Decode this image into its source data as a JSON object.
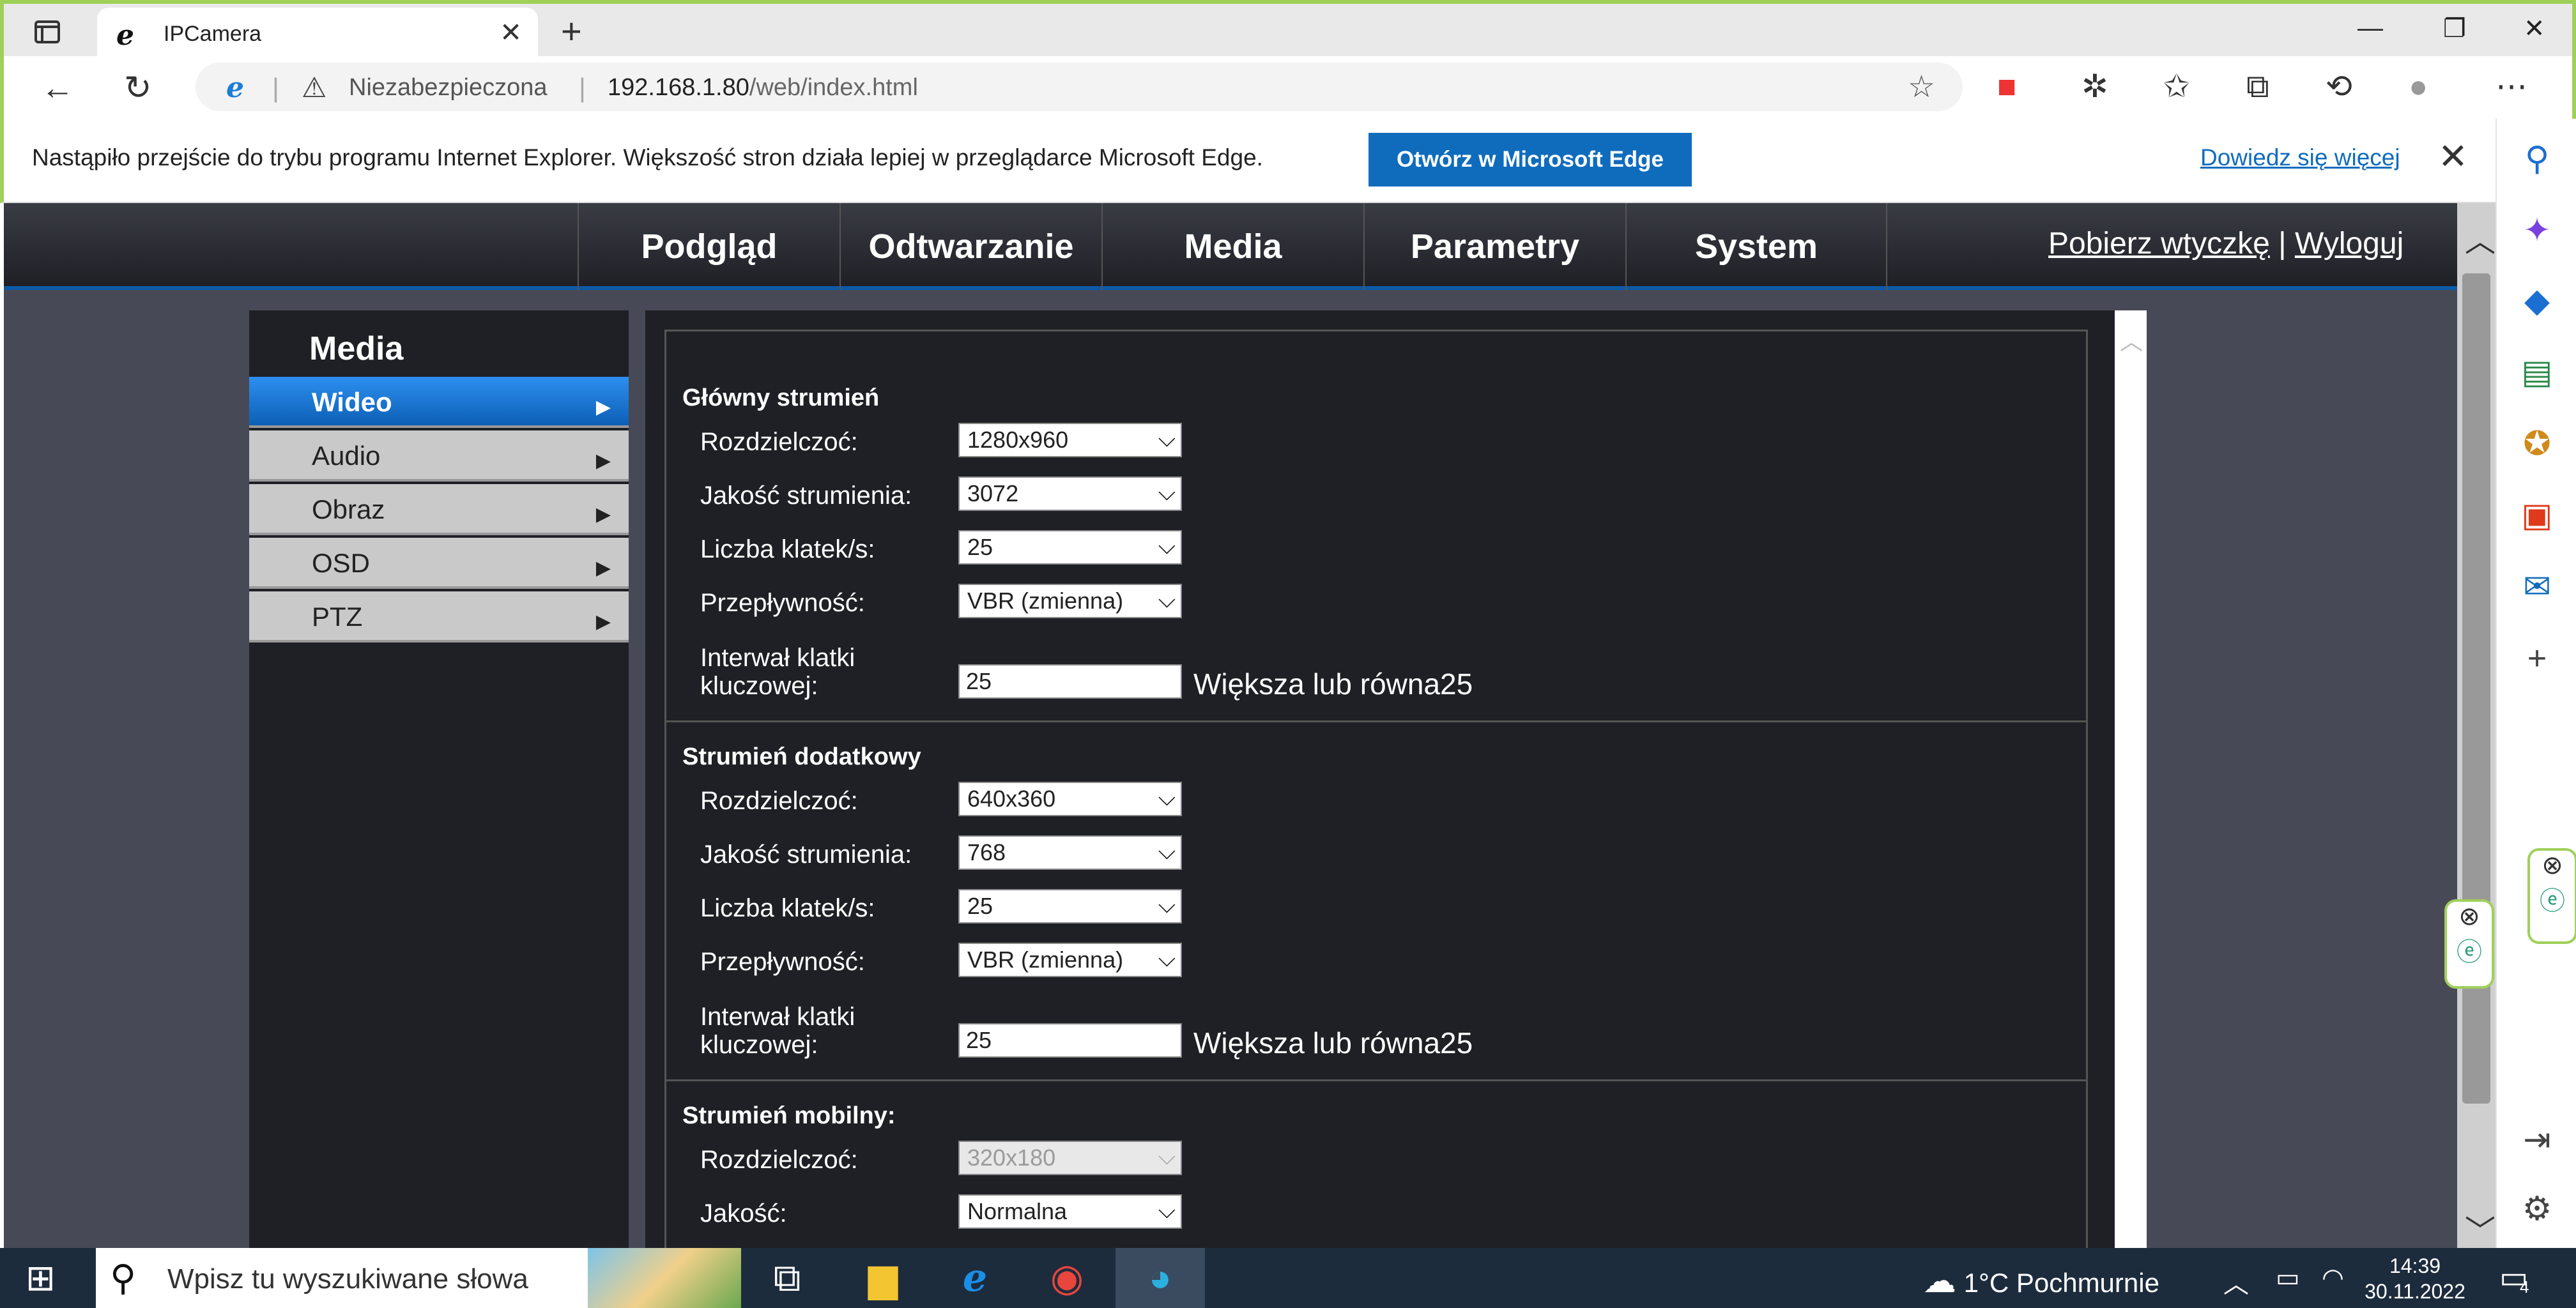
{
  "browser": {
    "tab_title": "IPCamera",
    "security_label": "Niezabezpieczona",
    "url_host": "192.168.1.80",
    "url_path": "/web/index.html",
    "window_controls": [
      "minimize-icon",
      "restore-icon",
      "close-icon"
    ]
  },
  "infobar": {
    "message": "Nastąpiło przejście do trybu programu Internet Explorer. Większość stron działa lepiej w przeglądarce Microsoft Edge.",
    "open_button": "Otwórz w Microsoft Edge",
    "learn_more": "Dowiedz się więcej"
  },
  "camera": {
    "menu": [
      "Podgląd",
      "Odtwarzanie",
      "Media",
      "Parametry",
      "System"
    ],
    "plugin_link": "Pobierz wtyczkę",
    "separator": "|",
    "logout_link": "Wyloguj",
    "left_menu_title": "Media",
    "left_menu": [
      "Wideo",
      "Audio",
      "Obraz",
      "OSD",
      "PTZ"
    ],
    "active_left_menu": "Wideo",
    "main_stream": {
      "title": "Główny strumień",
      "resolution_label": "Rozdzielczoć:",
      "resolution": "1280x960",
      "quality_label": "Jakość strumienia:",
      "quality": "3072",
      "fps_label": "Liczba klatek/s:",
      "fps": "25",
      "bitrate_label": "Przepływność:",
      "bitrate": "VBR (zmienna)",
      "keyframe_label_1": "Interwał klatki",
      "keyframe_label_2": "kluczowej:",
      "keyframe": "25",
      "keyframe_hint": "Większa lub równa25"
    },
    "sub_stream": {
      "title": "Strumień dodatkowy",
      "resolution_label": "Rozdzielczoć:",
      "resolution": "640x360",
      "quality_label": "Jakość strumienia:",
      "quality": "768",
      "fps_label": "Liczba klatek/s:",
      "fps": "25",
      "bitrate_label": "Przepływność:",
      "bitrate": "VBR (zmienna)",
      "keyframe_label_1": "Interwał klatki",
      "keyframe_label_2": "kluczowej:",
      "keyframe": "25",
      "keyframe_hint": "Większa lub równa25"
    },
    "mobile_stream": {
      "title": "Strumień mobilny:",
      "resolution_label": "Rozdzielczoć:",
      "resolution": "320x180",
      "quality_label": "Jakość:",
      "quality": "Normalna"
    }
  },
  "taskbar": {
    "search_placeholder": "Wpisz tu wyszukiwane słowa",
    "temperature": "1°C",
    "weather": "Pochmurnie",
    "time": "14:39",
    "date": "30.11.2022",
    "notification_count": "4"
  },
  "colors": {
    "accent_blue": "#0f6cbd",
    "ie_green_border": "#9fd05a",
    "camera_dark": "#1f2026",
    "menu_active": "#1a7fd6"
  }
}
